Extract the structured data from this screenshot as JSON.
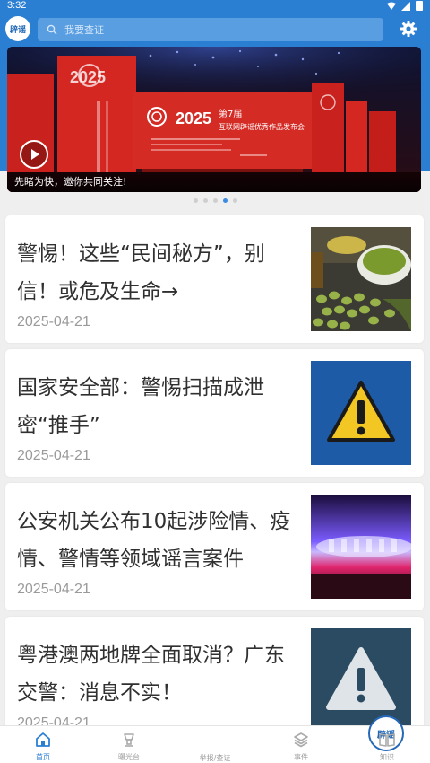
{
  "status_bar": {
    "time": "3:32"
  },
  "header": {
    "logo_text": "辟谣",
    "search_placeholder": "我要查证"
  },
  "banner": {
    "caption": "先睹为快，邀你共同关注!",
    "dot_count": 5,
    "active_dot": 3,
    "stage_year": "2025",
    "stage_edition": "第7届",
    "stage_title": "互联网辟谣优秀作品发布会"
  },
  "news": [
    {
      "title": "警惕！这些“民间秘方”，别信！或危及生命→",
      "date": "2025-04-21",
      "thumb": "herbal-pills-image"
    },
    {
      "title": "国家安全部：警惕扫描成泄密“推手”",
      "date": "2025-04-21",
      "thumb": "warning-sign-image"
    },
    {
      "title": "公安机关公布10起涉险情、疫情、警情等领域谣言案件",
      "date": "2025-04-21",
      "thumb": "police-light-image"
    },
    {
      "title": "粤港澳两地牌全面取消？广东交警：消息不实！",
      "date": "2025-04-21",
      "thumb": "warning-sign-image"
    }
  ],
  "bottom_nav": {
    "items": [
      {
        "label": "首页",
        "icon": "home-icon",
        "active": true
      },
      {
        "label": "曝光台",
        "icon": "spotlight-icon",
        "active": false
      },
      {
        "label": "举报/查证",
        "icon": "piyao-logo-icon",
        "active": false
      },
      {
        "label": "事件",
        "icon": "layers-icon",
        "active": false
      },
      {
        "label": "知识",
        "icon": "book-icon",
        "active": false
      }
    ],
    "center_logo_text": "辟谣"
  },
  "colors": {
    "accent": "#2b7fd3",
    "card_bg": "#ffffff",
    "page_bg": "#efefef",
    "date_text": "#9a9a9a"
  }
}
